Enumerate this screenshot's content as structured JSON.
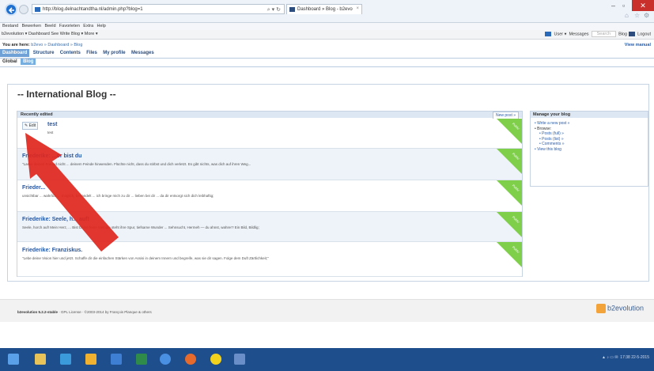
{
  "browser": {
    "url": "http://blog.delnachtandtha.nl/admin.php?blog=1",
    "tab_title": "Dashboard » Blog - b2evo",
    "menu": [
      "Bestand",
      "Bewerken",
      "Beeld",
      "Favorieten",
      "Extra",
      "Help"
    ]
  },
  "evobar": {
    "left": "b2evolution ▾  Dashboard  See  Write  Blog ▾  More ▾",
    "right_user": "User ▾",
    "right_messages": "Messages",
    "right_search": "Search",
    "right_blog": "Blog",
    "right_logout": "Logout"
  },
  "breadcrumb": {
    "prefix": "You are here:",
    "path": "b2evo » Dashboard » Blog",
    "manual": "View manual"
  },
  "main_tabs": [
    "Dashboard",
    "Structure",
    "Contents",
    "Files",
    "My profile",
    "Messages"
  ],
  "sub_tabs": [
    "Global",
    "Blog"
  ],
  "blog_title": "-- International Blog --",
  "recent": {
    "header": "Recently edited",
    "new_post": "New post »",
    "edit_label": "Edit",
    "ribbon": "Public",
    "posts": [
      {
        "title": "test",
        "excerpt": "test"
      },
      {
        "title": "Friederike: ...or bist du",
        "excerpt": "\"Lasse deinen Freund nicht ... deinem Feinde hinwenden. Flüchte nicht, dass du stirbst und dich verletzt. Es gibt nichts, was dich auf ihren Weg..."
      },
      {
        "title": "Frieder...",
        "excerpt": "unsichtbar ... wahrlich ... möglich, behandelt ... ich bringe mich zu dir ... lieben bei dir ... da dir entsorgt sich dich leibhaftig;"
      },
      {
        "title": "Friederike: Seele, h... auf!",
        "excerpt": "Seele, horch auf! Mein Herz, ... Bist Deine feine Melodie steht ihre Spur, tiefsame Wunder ... Sehnsucht, Hermeh — du ahnst, wahrer? Ein Bild, Bildlig;"
      },
      {
        "title": "Friederike: Franziskus.",
        "excerpt": "\"Lebe deine Vision hier und jetzt. Schaffe dir die einfachen Stärken von Assisi in deinem Innern und begreife, was sie dir sagen. Folge dem Duft Zärtlichkeit;\""
      }
    ]
  },
  "manage": {
    "title": "Manage your blog",
    "write": "Write a new post »",
    "browse": "Browse:",
    "posts_full": "Posts (full) »",
    "posts_list": "Posts (list) »",
    "comments": "Comments »",
    "view": "View this blog"
  },
  "footer": {
    "brand": "b2evolution 5.2.2-stable",
    "rest": "· GPL License · ©2003-2014 by François Planque & others",
    "logo": "b2evolution"
  },
  "tray": {
    "time": "17:38",
    "date": "22-5-2015"
  },
  "colors": {
    "accent": "#6fa0d6",
    "link": "#2458a6",
    "ribbon": "#7fcf4a",
    "arrow": "#e0261d",
    "taskbar": "#1f4e8c"
  }
}
